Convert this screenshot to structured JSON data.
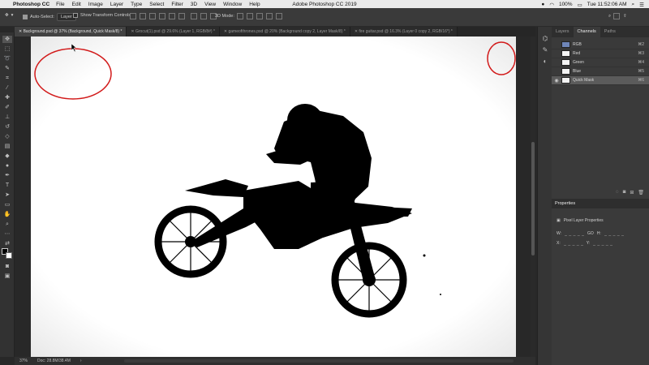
{
  "menubar": {
    "app_name": "Photoshop CC",
    "items": [
      "File",
      "Edit",
      "Image",
      "Layer",
      "Type",
      "Select",
      "Filter",
      "3D",
      "View",
      "Window",
      "Help"
    ],
    "window_title": "Adobe Photoshop CC 2019",
    "battery": "100%",
    "clock": "Tue 11:52:06 AM"
  },
  "options": {
    "auto_select_label": "Auto-Select:",
    "auto_select_value": "Layer",
    "transform_controls_label": "Show Transform Controls",
    "mode_3d_label": "3D Mode:"
  },
  "tabs": [
    {
      "label": "Background.psd @ 37% (Background, Quick Mask/8) *",
      "active": true
    },
    {
      "label": "Grocut(1).psd @ 29.6% (Layer 1, RGB/8#) *",
      "active": false
    },
    {
      "label": "gameofthrones.psd @ 20% (Background copy 2, Layer Mask/8) *",
      "active": false
    },
    {
      "label": "fire guitar.psd @ 16.3% (Layer 0 copy 2, RGB/16*) *",
      "active": false
    }
  ],
  "status": {
    "zoom": "37%",
    "doc_size": "Doc: 28.8M/38.4M"
  },
  "panel_tabs": [
    "Layers",
    "Channels",
    "Paths"
  ],
  "channels": [
    {
      "name": "RGB",
      "shortcut": "⌘2",
      "selected": false
    },
    {
      "name": "Red",
      "shortcut": "⌘3",
      "selected": false
    },
    {
      "name": "Green",
      "shortcut": "⌘4",
      "selected": false
    },
    {
      "name": "Blue",
      "shortcut": "⌘5",
      "selected": false
    },
    {
      "name": "Quick Mask",
      "shortcut": "⌘6",
      "selected": true
    }
  ],
  "properties": {
    "title": "Properties",
    "subtitle": "Pixel Layer Properties",
    "w_label": "W:",
    "h_label": "H:",
    "link_label": "GO",
    "x_label": "X:",
    "y_label": "Y:"
  },
  "colors": {
    "annotation_red": "#d21a1a",
    "panel_bg": "#3a3a3a",
    "canvas_bg": "#ffffff"
  }
}
